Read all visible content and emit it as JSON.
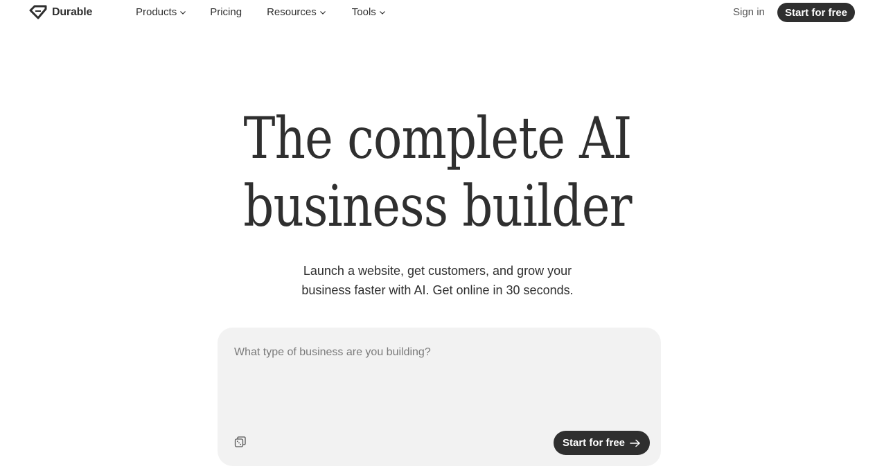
{
  "header": {
    "brand": "Durable",
    "nav": [
      {
        "label": "Products",
        "icon": "chevron-down-icon"
      },
      {
        "label": "Pricing"
      },
      {
        "label": "Resources",
        "icon": "chevron-down-icon"
      },
      {
        "label": "Tools",
        "icon": "chevron-down-icon"
      }
    ],
    "sign_in": "Sign in",
    "cta": "Start for free"
  },
  "hero": {
    "title_line1": "The complete AI",
    "title_line2": "business builder",
    "subtitle_line1": "Launch a website, get customers, and grow your",
    "subtitle_line2": "business faster with AI. Get online in 30 seconds."
  },
  "prompt": {
    "placeholder": "What type of business are you building?",
    "value": "",
    "random_icon": "dice-icon",
    "submit_label": "Start for free",
    "submit_icon": "arrow-right-icon"
  },
  "colors": {
    "text": "#2f2f2f",
    "button_bg": "#2f2f2f",
    "input_bg": "#f2f2f2",
    "placeholder": "#7a7a7a"
  }
}
